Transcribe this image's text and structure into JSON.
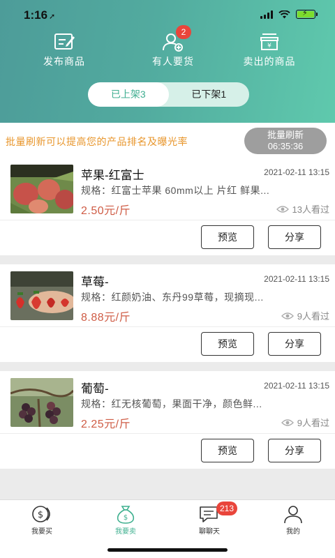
{
  "status_bar": {
    "time": "1:16"
  },
  "top_actions": [
    {
      "label": "发布商品",
      "icon": "edit-icon"
    },
    {
      "label": "有人要货",
      "icon": "user-add-icon",
      "badge": "2"
    },
    {
      "label": "卖出的商品",
      "icon": "cashbox-icon"
    }
  ],
  "tabs": {
    "listed": "已上架3",
    "unlisted": "已下架1"
  },
  "notice": {
    "text": "批量刷新可以提高您的产品排名及曝光率",
    "refresh_label": "批量刷新",
    "countdown": "06:35:36"
  },
  "products": [
    {
      "title": "苹果-红富士",
      "date": "2021-02-11 13:15",
      "spec": "规格：红富士苹果 60mm以上 片红 鲜果...",
      "price": "2.50元/斤",
      "views": "13人看过",
      "preview": "预览",
      "share": "分享"
    },
    {
      "title": "草莓-",
      "date": "2021-02-11 13:15",
      "spec": "规格：红颜奶油、东丹99草莓，现摘现...",
      "price": "8.88元/斤",
      "views": "9人看过",
      "preview": "预览",
      "share": "分享"
    },
    {
      "title": "葡萄-",
      "date": "2021-02-11 13:15",
      "spec": "规格：红无核葡萄，果面干净，颜色鲜...",
      "price": "2.25元/斤",
      "views": "9人看过",
      "preview": "预览",
      "share": "分享"
    }
  ],
  "tab_bar": [
    {
      "label": "我要买",
      "icon": "dollar-coin-icon"
    },
    {
      "label": "我要卖",
      "icon": "money-bag-icon",
      "active": true
    },
    {
      "label": "聊聊天",
      "icon": "chat-icon",
      "badge": "213"
    },
    {
      "label": "我的",
      "icon": "person-icon"
    }
  ],
  "colors": {
    "accent": "#3fb08f",
    "price": "#cf5c45",
    "notice": "#e8962c",
    "badge": "#e9453b"
  }
}
